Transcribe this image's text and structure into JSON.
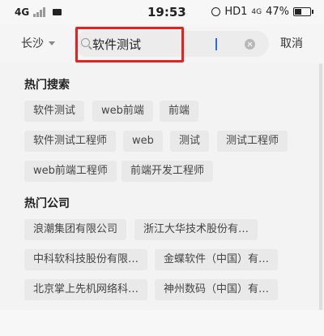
{
  "status_bar": {
    "network": "4G",
    "time": "19:53",
    "right": "HD1",
    "network2": "4G",
    "battery": "47%",
    "battery_level": 0.47
  },
  "header": {
    "city": "长沙",
    "search_value": "软件测试",
    "cancel_label": "取消"
  },
  "hot_search": {
    "title": "热门搜索",
    "tags": [
      "软件测试",
      "web前端",
      "前端",
      "软件测试工程师",
      "web",
      "测试",
      "测试工程师",
      "web前端工程师",
      "前端开发工程师"
    ]
  },
  "hot_company": {
    "title": "热门公司",
    "tags": [
      "浪潮集团有限公司",
      "浙江大华技术股份有…",
      "中科软科技股份有限…",
      "金蝶软件（中国）有…",
      "北京掌上先机网络科…",
      "神州数码（中国）有…"
    ]
  },
  "colors": {
    "highlight": "#e8201e",
    "cursor": "#2a6ce8"
  }
}
